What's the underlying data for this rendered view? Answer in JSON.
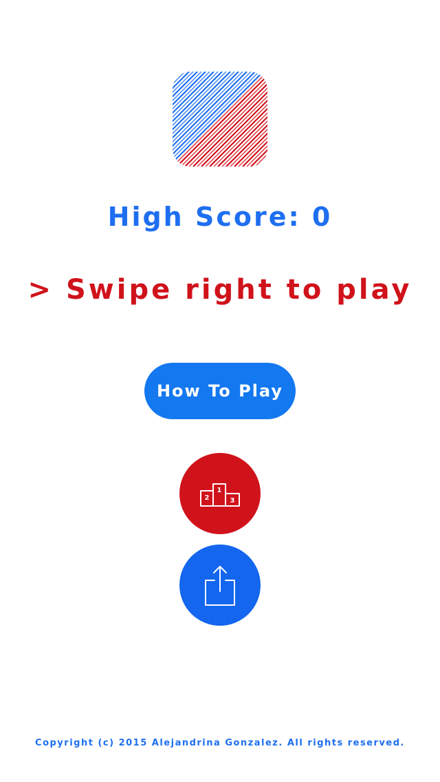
{
  "colors": {
    "blue": "#1E6FF0",
    "red": "#D0121B",
    "button_blue": "#1478F0",
    "share_blue": "#1466EE",
    "background": "#ffffff"
  },
  "logo": {
    "icon": "diagonal-stripes-logo"
  },
  "high_score": {
    "text": "High Score: 0"
  },
  "swipe_prompt": {
    "text": "> Swipe right to play"
  },
  "how_to_play_button": {
    "label": "How To Play"
  },
  "leaderboard_button": {
    "icon": "podium-icon",
    "places": [
      "1",
      "2",
      "3"
    ]
  },
  "share_button": {
    "icon": "share-icon"
  },
  "footer": {
    "copyright": "Copyright (c) 2015 Alejandrina Gonzalez. All rights reserved."
  }
}
